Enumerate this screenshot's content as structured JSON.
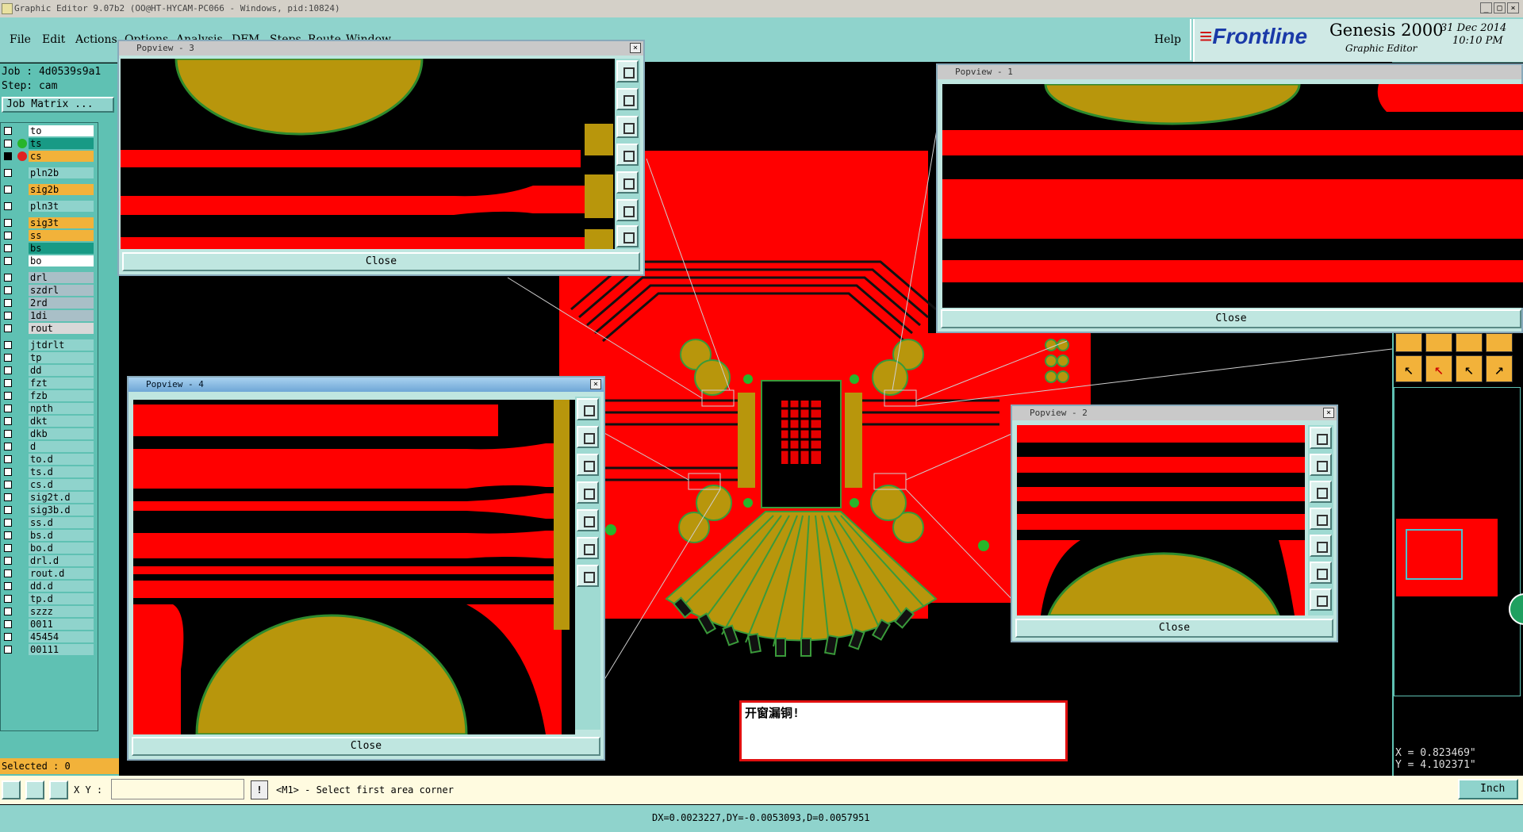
{
  "window": {
    "title": "Graphic Editor 9.07b2 (OO@HT-HYCAM-PC066 - Windows, pid:10824)"
  },
  "menu": {
    "items": [
      "File",
      "Edit",
      "Actions",
      "Options",
      "Analysis",
      "DFM",
      "Steps",
      "Route",
      "Window"
    ],
    "help": "Help"
  },
  "brand": {
    "frontline": "Frontline",
    "product": "Genesis 2000",
    "subtitle": "Graphic Editor",
    "date": "31 Dec 2014",
    "time": "10:10 PM"
  },
  "job": {
    "job_line": "Job : 4d0539s9a1",
    "step_line": "Step: cam",
    "matrix_button": "Job Matrix ..."
  },
  "layers": [
    "to",
    "ts",
    "cs",
    "pln2b",
    "sig2b",
    "pln3t",
    "sig3t",
    "ss",
    "bs",
    "bo",
    "drl",
    "szdrl",
    "2rd",
    "1di",
    "rout",
    "jtdrlt",
    "tp",
    "dd",
    "fzt",
    "fzb",
    "npth",
    "dkt",
    "dkb",
    "d",
    "to.d",
    "ts.d",
    "cs.d",
    "sig2t.d",
    "sig3b.d",
    "ss.d",
    "bs.d",
    "bo.d",
    "drl.d",
    "rout.d",
    "dd.d",
    "tp.d",
    "szzz",
    "0011",
    "45454",
    "00111"
  ],
  "selected": "Selected : 0",
  "popviews": [
    {
      "title": "Popview - 3",
      "close": "Close"
    },
    {
      "title": "Popview - 1",
      "close": "Close"
    },
    {
      "title": "Popview - 4",
      "close": "Close"
    },
    {
      "title": "Popview - 2",
      "close": "Close"
    }
  ],
  "note": {
    "text": "开窗漏铜!"
  },
  "coords": {
    "x": "X = 0.823469\"",
    "y": "Y = 4.102371\""
  },
  "status": {
    "xy_label": "X Y :",
    "xy_value": "",
    "prompt": "<M1> - Select first area corner",
    "unit": "Inch",
    "delta": "DX=0.0023227,DY=-0.0053093,D=0.0057951"
  },
  "colors": {
    "copper": "#ff0000",
    "pad": "#b8960c",
    "panel": "#5fc1b3",
    "bar": "#8fd3cc"
  }
}
